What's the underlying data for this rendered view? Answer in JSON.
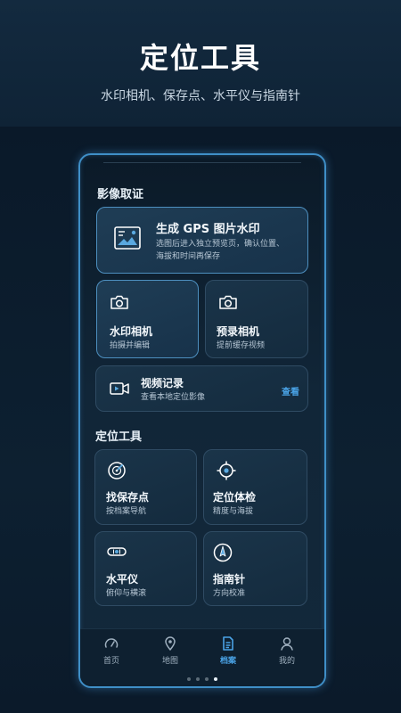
{
  "hero": {
    "title": "定位工具",
    "subtitle": "水印相机、保存点、水平仪与指南针"
  },
  "sections": {
    "imaging": {
      "title": "影像取证",
      "gps_card": {
        "title": "生成 GPS 图片水印",
        "desc_line1": "选图后进入独立预览页，确认位置、",
        "desc_line2": "海拔和时间再保存",
        "icon": "image-icon"
      },
      "watermark_camera": {
        "title": "水印相机",
        "desc": "拍摄并编辑",
        "icon": "camera-icon"
      },
      "prerecord_camera": {
        "title": "预录相机",
        "desc": "提前缓存视频",
        "icon": "camera-icon"
      },
      "video_record": {
        "title": "视频记录",
        "desc": "查看本地定位影像",
        "link": "查看",
        "icon": "video-camera-icon"
      }
    },
    "location_tools": {
      "title": "定位工具",
      "items": [
        {
          "title": "找保存点",
          "desc": "按档案导航",
          "icon": "radar-icon"
        },
        {
          "title": "定位体检",
          "desc": "精度与海拔",
          "icon": "crosshair-icon"
        },
        {
          "title": "水平仪",
          "desc": "俯仰与横滚",
          "icon": "level-icon"
        },
        {
          "title": "指南针",
          "desc": "方向校准",
          "icon": "compass-icon"
        }
      ]
    }
  },
  "tabbar": {
    "items": [
      {
        "label": "首页",
        "icon": "gauge-icon",
        "active": false
      },
      {
        "label": "地图",
        "icon": "map-pin-icon",
        "active": false
      },
      {
        "label": "档案",
        "icon": "document-icon",
        "active": true
      },
      {
        "label": "我的",
        "icon": "user-icon",
        "active": false
      }
    ]
  },
  "pager": {
    "count": 4,
    "current": 4
  },
  "colors": {
    "accent": "#4aa3e6",
    "background": "#0b1a2a",
    "card": "#17304a",
    "border_glow": "#3f8fc7"
  }
}
